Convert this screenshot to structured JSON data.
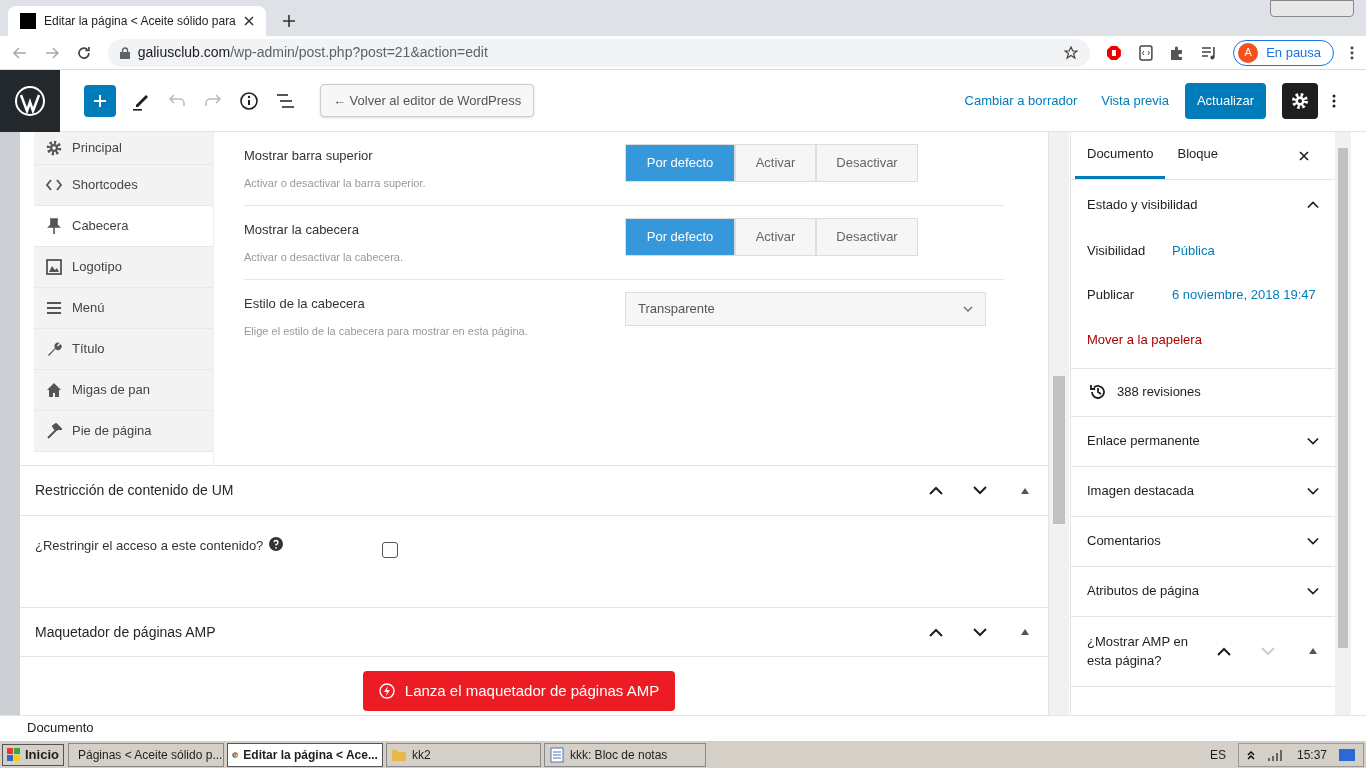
{
  "browser": {
    "tab": {
      "title": "Editar la página < Aceite sólido para"
    },
    "address": {
      "host": "galiusclub.com",
      "path": "/wp-admin/post.php?post=21&action=edit"
    },
    "profile": {
      "initial": "A",
      "label": "En pausa"
    }
  },
  "editor_toolbar": {
    "back_button": "← Volver al editor de WordPress",
    "links": [
      "Cambiar a borrador",
      "Vista previa"
    ],
    "primary_button": "Actualizar"
  },
  "settings_nav": [
    {
      "label": "Principal",
      "selected": false
    },
    {
      "label": "Shortcodes",
      "selected": false
    },
    {
      "label": "Cabecera",
      "selected": true
    },
    {
      "label": "Logotipo",
      "selected": false
    },
    {
      "label": "Menú",
      "selected": false
    },
    {
      "label": "Título",
      "selected": false
    },
    {
      "label": "Migas de pan",
      "selected": false
    },
    {
      "label": "Pie de página",
      "selected": false
    }
  ],
  "settings": [
    {
      "kind": "toggle",
      "label": "Mostrar barra superior",
      "description": "Activar o desactivar la barra superior.",
      "options": [
        {
          "label": "Por defecto",
          "selected": true
        },
        {
          "label": "Activar",
          "selected": false
        },
        {
          "label": "Desactivar",
          "selected": false
        }
      ]
    },
    {
      "kind": "toggle",
      "label": "Mostrar la cabecera",
      "description": "Activar o desactivar la cabecera.",
      "options": [
        {
          "label": "Por defecto",
          "selected": true
        },
        {
          "label": "Activar",
          "selected": false
        },
        {
          "label": "Desactivar",
          "selected": false
        }
      ]
    },
    {
      "kind": "select",
      "label": "Estilo de la cabecera",
      "description": "Elige el estilo de la cabecera para mostrar en esta página.",
      "value": "Transparente"
    }
  ],
  "metaboxes": [
    {
      "title": "Restricción de contenido de UM",
      "field": {
        "label": "¿Restringir el acceso a este contenido?",
        "checked": false
      }
    },
    {
      "title": "Maquetador de páginas AMP",
      "button": "Lanza el maquetador de páginas AMP"
    }
  ],
  "sidebar": {
    "tabs": [
      {
        "label": "Documento",
        "selected": true
      },
      {
        "label": "Bloque",
        "selected": false
      }
    ],
    "panels": [
      {
        "kind": "panel",
        "title": "Estado y visibilidad",
        "expanded": true,
        "rows": [
          {
            "label": "Visibilidad",
            "value": "Pública"
          },
          {
            "label": "Publicar",
            "value": "6 noviembre, 2018 19:47"
          }
        ],
        "trash_link": "Mover a la papelera"
      },
      {
        "kind": "revisions",
        "title": "388 revisiones"
      },
      {
        "kind": "panel",
        "title": "Enlace permanente",
        "expanded": false
      },
      {
        "kind": "panel",
        "title": "Imagen destacada",
        "expanded": false
      },
      {
        "kind": "panel",
        "title": "Comentarios",
        "expanded": false
      },
      {
        "kind": "panel",
        "title": "Atributos de página",
        "expanded": false
      },
      {
        "kind": "metabox",
        "title": "¿Mostrar AMP en esta página?"
      }
    ]
  },
  "status_bar": "Documento",
  "taskbar": {
    "start": "Inicio",
    "items": [
      {
        "label": "Páginas < Aceite sólido p...",
        "selected": false
      },
      {
        "label": "Editar la página < Ace...",
        "selected": true
      },
      {
        "label": "kk2",
        "selected": false
      },
      {
        "label": "kkk: Bloc de notas",
        "selected": false
      }
    ],
    "language": "ES",
    "time": "15:37"
  }
}
